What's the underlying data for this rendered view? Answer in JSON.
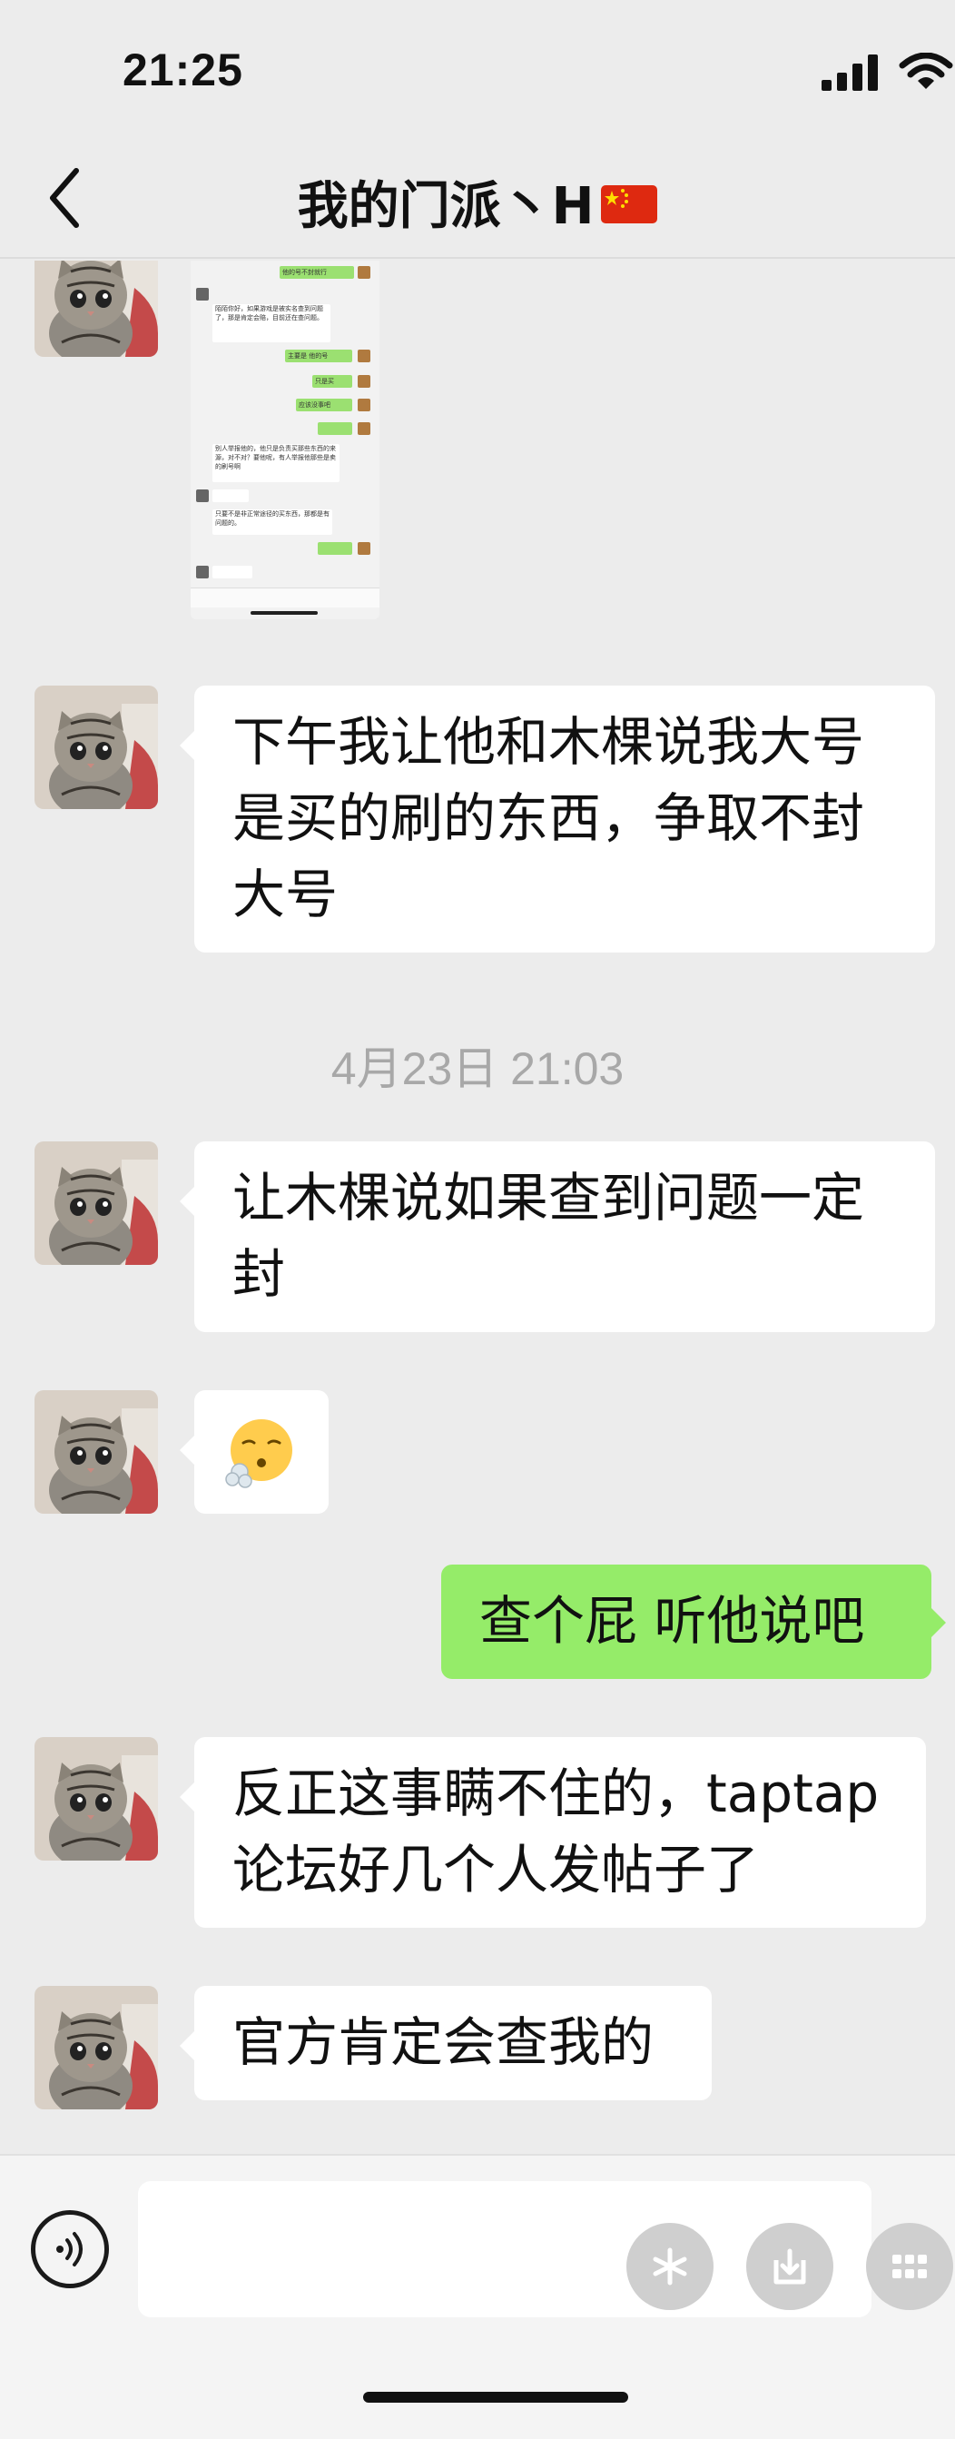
{
  "status_bar": {
    "time": "21:25"
  },
  "header": {
    "title": "我的门派丶H"
  },
  "screenshot_message": {
    "lines": [
      "他的号不封就行",
      "陌陌你好，如果游戏是被实名查到问题了，那是肯定会赔，目前还在查问题。",
      "主要是 他的号",
      "只是买",
      "应该没事吧",
      "别人举报他的，他只是负责买那些东西的来源，对不对？要他呢，有人举报他那些是卖的刷号啊",
      "只要不是非正常途径的买东西，那都是有问题的。"
    ]
  },
  "messages": [
    {
      "side": "left",
      "text": "下午我让他和木棵说我大号是买的刷的东西，争取不封大号"
    },
    {
      "side": "time",
      "text": "4月23日 21:03"
    },
    {
      "side": "left",
      "text": "让木棵说如果查到问题一定封"
    },
    {
      "side": "left",
      "text": "😮‍💨"
    },
    {
      "side": "right",
      "text": "查个屁  听他说吧"
    },
    {
      "side": "left",
      "text": "反正这事瞒不住的，taptap论坛好几个人发帖子了"
    },
    {
      "side": "left",
      "text": "官方肯定会查我的"
    }
  ],
  "input_bar": {
    "placeholder": ""
  }
}
